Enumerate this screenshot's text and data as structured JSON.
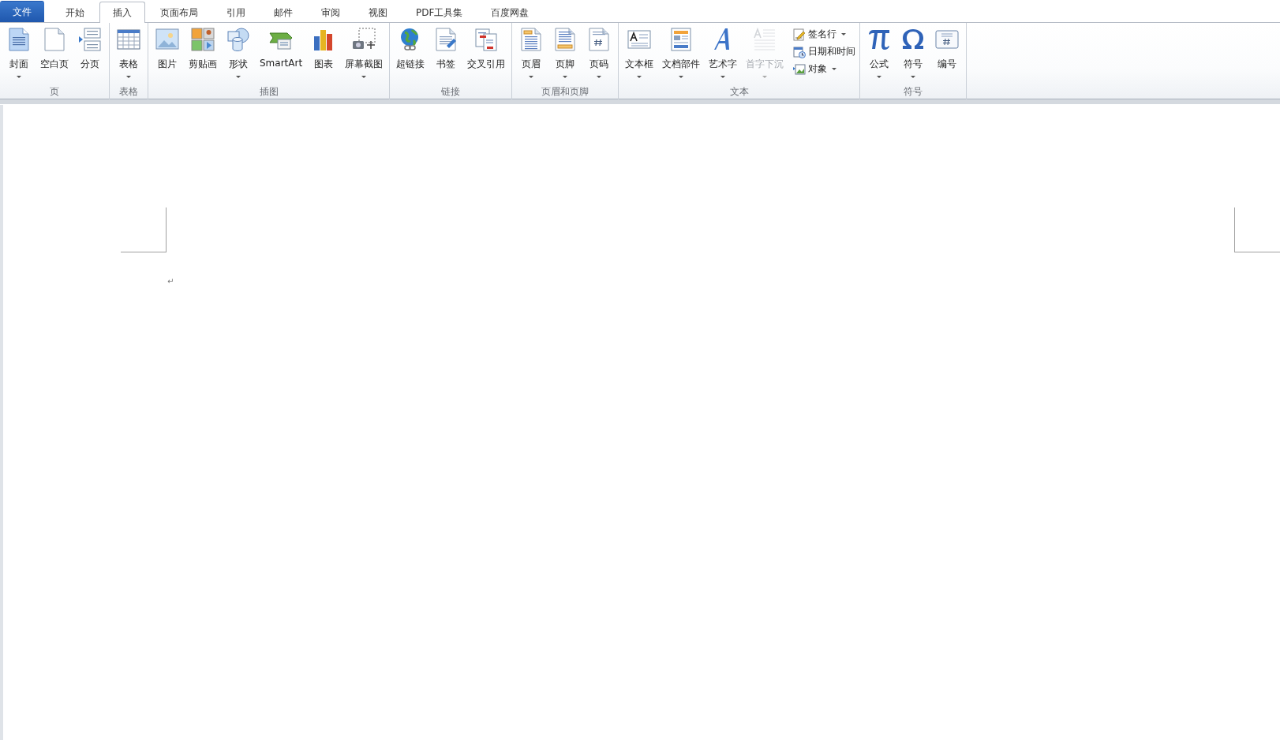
{
  "tabs": [
    {
      "label": "文件",
      "kind": "file",
      "selected": false
    },
    {
      "label": "开始",
      "kind": "tab",
      "selected": false
    },
    {
      "label": "插入",
      "kind": "tab",
      "selected": true
    },
    {
      "label": "页面布局",
      "kind": "tab",
      "selected": false
    },
    {
      "label": "引用",
      "kind": "tab",
      "selected": false
    },
    {
      "label": "邮件",
      "kind": "tab",
      "selected": false
    },
    {
      "label": "审阅",
      "kind": "tab",
      "selected": false
    },
    {
      "label": "视图",
      "kind": "tab",
      "selected": false
    },
    {
      "label": "PDF工具集",
      "kind": "tab",
      "selected": false
    },
    {
      "label": "百度网盘",
      "kind": "tab",
      "selected": false
    }
  ],
  "ribbon": {
    "groups": [
      {
        "label": "页",
        "buttons": [
          {
            "kind": "large",
            "label": "封面",
            "dropdown": true,
            "disabled": false
          },
          {
            "kind": "large",
            "label": "空白页",
            "dropdown": false,
            "disabled": false
          },
          {
            "kind": "large",
            "label": "分页",
            "dropdown": false,
            "disabled": false
          }
        ]
      },
      {
        "label": "表格",
        "buttons": [
          {
            "kind": "large",
            "label": "表格",
            "dropdown": true,
            "disabled": false
          }
        ]
      },
      {
        "label": "插图",
        "buttons": [
          {
            "kind": "large",
            "label": "图片",
            "dropdown": false,
            "disabled": false
          },
          {
            "kind": "large",
            "label": "剪贴画",
            "dropdown": false,
            "disabled": false
          },
          {
            "kind": "large",
            "label": "形状",
            "dropdown": true,
            "disabled": false
          },
          {
            "kind": "large",
            "label": "SmartArt",
            "dropdown": false,
            "disabled": false
          },
          {
            "kind": "large",
            "label": "图表",
            "dropdown": false,
            "disabled": false
          },
          {
            "kind": "large",
            "label": "屏幕截图",
            "dropdown": true,
            "disabled": false
          }
        ]
      },
      {
        "label": "链接",
        "buttons": [
          {
            "kind": "large",
            "label": "超链接",
            "dropdown": false,
            "disabled": false
          },
          {
            "kind": "large",
            "label": "书签",
            "dropdown": false,
            "disabled": false
          },
          {
            "kind": "large",
            "label": "交叉引用",
            "dropdown": false,
            "disabled": false
          }
        ]
      },
      {
        "label": "页眉和页脚",
        "buttons": [
          {
            "kind": "large",
            "label": "页眉",
            "dropdown": true,
            "disabled": false
          },
          {
            "kind": "large",
            "label": "页脚",
            "dropdown": true,
            "disabled": false
          },
          {
            "kind": "large",
            "label": "页码",
            "dropdown": true,
            "disabled": false
          }
        ]
      },
      {
        "label": "文本",
        "buttons": [
          {
            "kind": "large",
            "label": "文本框",
            "dropdown": true,
            "disabled": false
          },
          {
            "kind": "large",
            "label": "文档部件",
            "dropdown": true,
            "disabled": false
          },
          {
            "kind": "large",
            "label": "艺术字",
            "dropdown": true,
            "disabled": false
          },
          {
            "kind": "large",
            "label": "首字下沉",
            "dropdown": true,
            "disabled": true
          },
          {
            "kind": "small",
            "label": "签名行",
            "dropdown": true,
            "disabled": false
          },
          {
            "kind": "small",
            "label": "日期和时间",
            "dropdown": false,
            "disabled": false
          },
          {
            "kind": "small",
            "label": "对象",
            "dropdown": true,
            "disabled": false
          }
        ]
      },
      {
        "label": "符号",
        "buttons": [
          {
            "kind": "large",
            "label": "公式",
            "dropdown": true,
            "disabled": false
          },
          {
            "kind": "large",
            "label": "符号",
            "dropdown": true,
            "disabled": false
          },
          {
            "kind": "large",
            "label": "编号",
            "dropdown": false,
            "disabled": false
          }
        ]
      }
    ]
  },
  "document": {
    "paragraph_mark": "↵"
  }
}
